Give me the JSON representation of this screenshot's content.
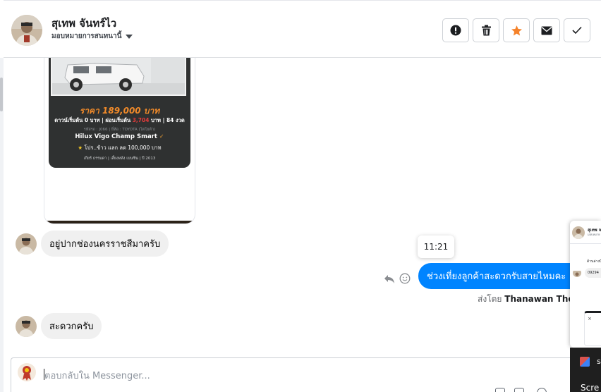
{
  "header": {
    "contact_name": "สุเทพ จันทร์ไว",
    "assign_label": "มอบหมายการสนทนานี้",
    "buttons": [
      {
        "name": "report-spam",
        "icon": "exclamation-icon"
      },
      {
        "name": "delete",
        "icon": "trash-icon"
      },
      {
        "name": "star",
        "icon": "star-icon",
        "color": "#f5822a"
      },
      {
        "name": "mark-unread",
        "icon": "envelope-icon"
      },
      {
        "name": "mark-done",
        "icon": "checkmark-icon"
      }
    ]
  },
  "ad_card": {
    "price": "ราคา 189,000 บาท",
    "down_prefix": "ดาวน์เริ่มต้น 0 บาท | ผ่อนเริ่มต้น ",
    "down_amount": "3,704",
    "down_suffix": " บาท | 84 งวด",
    "small_info": "รหัสรถ : J066 | ยี่ห้อ : TOYOTA (โตโยต้า)",
    "model": "Hilux Vigo Champ Smart",
    "promo": "โปร..ข้าว แลก ลด 100,000 บาท",
    "footer": "เกียร์ ธรรมดา | เลี้ยงหลัง เบนซิน | ปี 2013"
  },
  "messages": [
    {
      "direction": "in",
      "text": "อยู่ปากช่องนครราชสีมาครับ"
    },
    {
      "direction": "out",
      "text": "ช่วงเที่ยงลูกค้าสะดวกรับสายไหมคะ",
      "time": "11:21",
      "sent_by_label": "ส่งโดย",
      "sent_by_name": "Thanawan Thon"
    },
    {
      "direction": "in",
      "text": "สะดวกครับ"
    }
  ],
  "composer": {
    "placeholder": "ตอบกลับใน Messenger..."
  },
  "popup": {
    "name": "สุเทพ จ",
    "subtitle": "มอบหมาย",
    "text": "ด้านล่างนี",
    "bubble": "09294",
    "close": "×"
  },
  "taskbar": {
    "letter": "s",
    "label": "Scre"
  },
  "colors": {
    "accent": "#0084ff",
    "star": "#f5822a",
    "incoming_bubble": "#f0f0f0"
  }
}
